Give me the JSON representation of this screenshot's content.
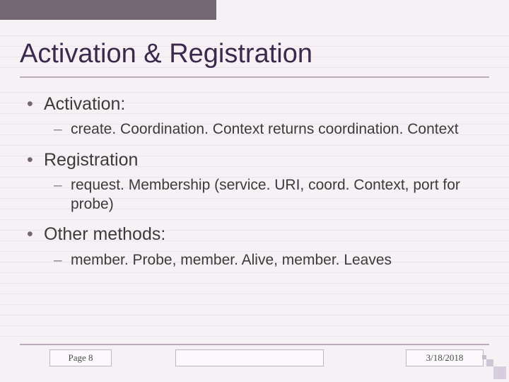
{
  "title": "Activation & Registration",
  "bullets": [
    {
      "label": "Activation:",
      "subs": [
        "create. Coordination. Context returns coordination. Context"
      ]
    },
    {
      "label": "Registration",
      "subs": [
        "request. Membership (service. URI, coord. Context, port for probe)"
      ]
    },
    {
      "label": "Other methods:",
      "subs": [
        "member. Probe, member. Alive, member. Leaves"
      ]
    }
  ],
  "footer": {
    "page": "Page 8",
    "date": "3/18/2018"
  }
}
